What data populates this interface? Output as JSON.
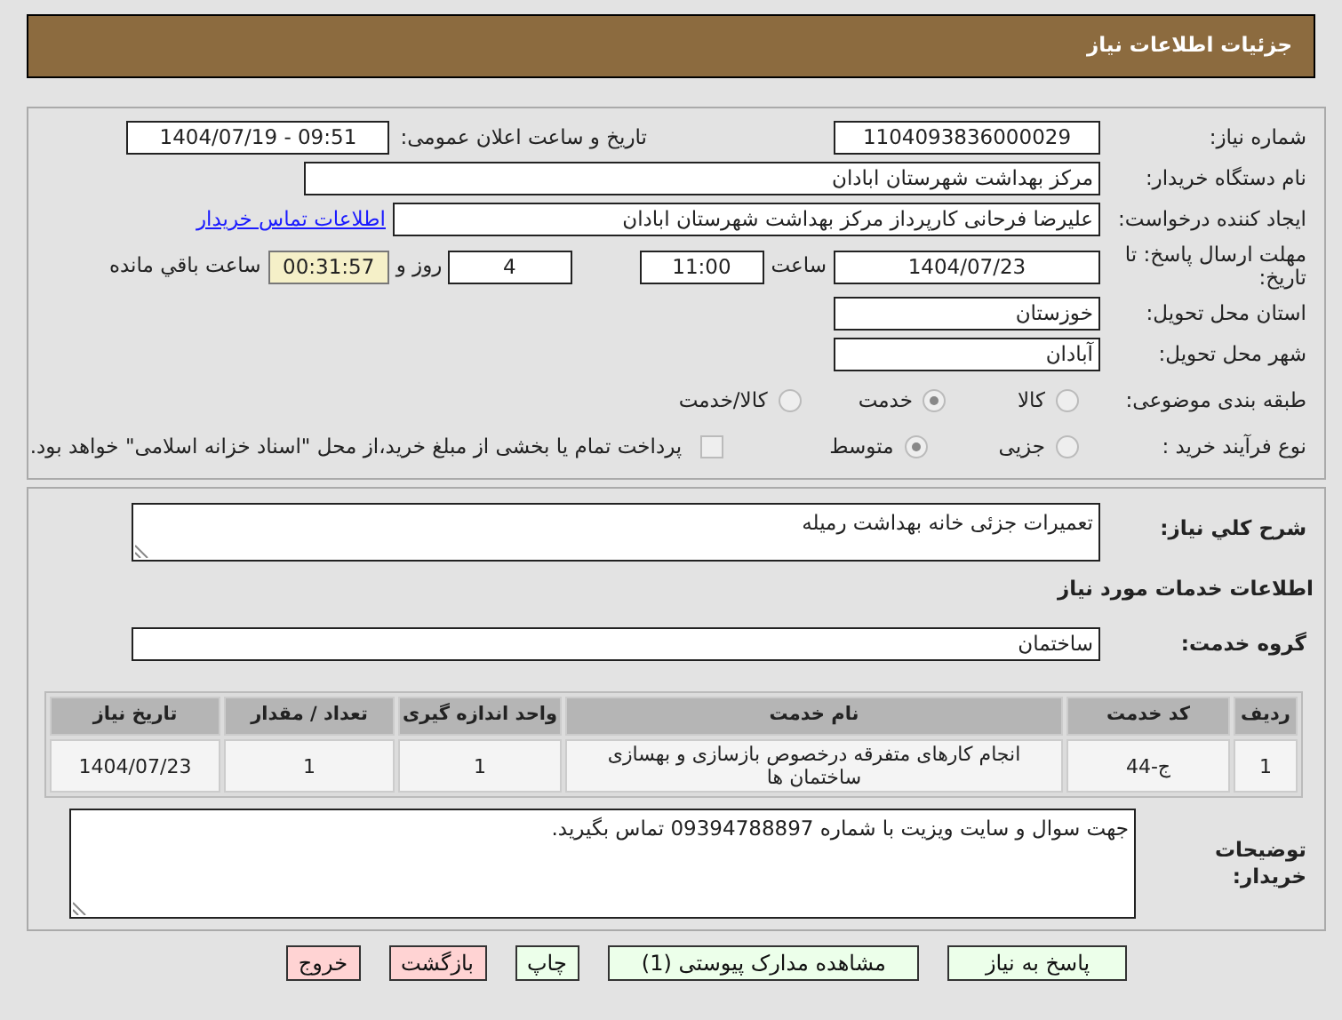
{
  "header": {
    "title": "جزئیات اطلاعات نیاز"
  },
  "need_number": {
    "label": "شماره نیاز:",
    "value": "1104093836000029"
  },
  "announce": {
    "label": "تاریخ و ساعت اعلان عمومی:",
    "value": "1404/07/19 - 09:51"
  },
  "buyer": {
    "label": "نام دستگاه خریدار:",
    "value": "مرکز بهداشت شهرستان ابادان"
  },
  "requester": {
    "label": "ایجاد کننده درخواست:",
    "value": "علیرضا فرحانی کارپرداز مرکز بهداشت شهرستان ابادان",
    "link": "اطلاعات تماس خریدار"
  },
  "deadline": {
    "label": "مهلت ارسال پاسخ: تا تاریخ:",
    "date": "1404/07/23",
    "time_label": "ساعت",
    "time": "11:00",
    "days": "4",
    "days_label": "روز و",
    "remaining": "00:31:57",
    "remaining_label": "ساعت باقي مانده"
  },
  "province": {
    "label": "استان محل تحویل:",
    "value": "خوزستان"
  },
  "city": {
    "label": "شهر محل تحویل:",
    "value": "آبادان"
  },
  "category": {
    "label": "طبقه بندی موضوعی:",
    "options": [
      {
        "label": "کالا",
        "selected": false
      },
      {
        "label": "خدمت",
        "selected": true
      },
      {
        "label": "کالا/خدمت",
        "selected": false
      }
    ]
  },
  "purchase_type": {
    "label": "نوع فرآیند خرید :",
    "options": [
      {
        "label": "جزیی",
        "selected": false
      },
      {
        "label": "متوسط",
        "selected": true
      }
    ],
    "treasury": {
      "checked": false,
      "text": "پرداخت تمام یا بخشی از مبلغ خرید،از محل \"اسناد خزانه اسلامی\" خواهد بود."
    }
  },
  "description": {
    "label": "شرح کلي نیاز:",
    "value": "تعمیرات جزئی خانه بهداشت رمیله"
  },
  "services_heading": "اطلاعات خدمات مورد نیاز",
  "service_group": {
    "label": "گروه خدمت:",
    "value": "ساختمان"
  },
  "table": {
    "columns": [
      "ردیف",
      "کد خدمت",
      "نام خدمت",
      "واحد اندازه گیری",
      "تعداد / مقدار",
      "تاریخ نیاز"
    ],
    "rows": [
      [
        "1",
        "ج-44",
        "انجام کارهای متفرقه درخصوص بازسازی و بهسازی ساختمان ها",
        "1",
        "1",
        "1404/07/23"
      ]
    ]
  },
  "buyer_notes": {
    "label": "توضیحات خریدار:",
    "value": "جهت سوال و سایت ویزیت با شماره 09394788897 تماس بگیرید."
  },
  "buttons": [
    {
      "label": "پاسخ به نیاز",
      "kind": "action"
    },
    {
      "label": "مشاهده مدارک پیوستی (1)",
      "kind": "action"
    },
    {
      "label": "چاپ",
      "kind": "action"
    },
    {
      "label": "بازگشت",
      "kind": "danger"
    },
    {
      "label": "خروج",
      "kind": "danger"
    }
  ]
}
